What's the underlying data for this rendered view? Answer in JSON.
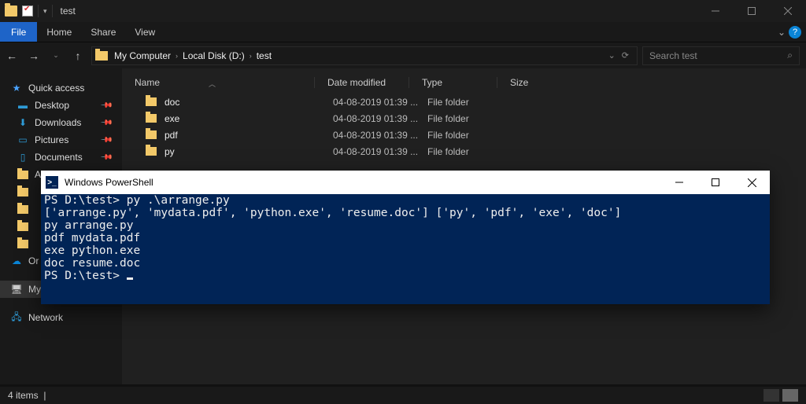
{
  "title": "test",
  "menus": {
    "file": "File",
    "home": "Home",
    "share": "Share",
    "view": "View"
  },
  "breadcrumbs": [
    "My Computer",
    "Local Disk (D:)",
    "test"
  ],
  "search_placeholder": "Search test",
  "columns": {
    "name": "Name",
    "date": "Date modified",
    "type": "Type",
    "size": "Size"
  },
  "rows": [
    {
      "name": "doc",
      "date": "04-08-2019 01:39 ...",
      "type": "File folder"
    },
    {
      "name": "exe",
      "date": "04-08-2019 01:39 ...",
      "type": "File folder"
    },
    {
      "name": "pdf",
      "date": "04-08-2019 01:39 ...",
      "type": "File folder"
    },
    {
      "name": "py",
      "date": "04-08-2019 01:39 ...",
      "type": "File folder"
    }
  ],
  "sidebar": {
    "quick": "Quick access",
    "items": [
      "Desktop",
      "Downloads",
      "Pictures",
      "Documents"
    ],
    "a": "A",
    "or": "Or",
    "my": "My",
    "network": "Network"
  },
  "status": "4 items",
  "ps": {
    "title": "Windows PowerShell",
    "lines": [
      "PS D:\\test> py .\\arrange.py",
      "['arrange.py', 'mydata.pdf', 'python.exe', 'resume.doc'] ['py', 'pdf', 'exe', 'doc']",
      "py arrange.py",
      "pdf mydata.pdf",
      "exe python.exe",
      "doc resume.doc",
      "PS D:\\test> "
    ]
  }
}
